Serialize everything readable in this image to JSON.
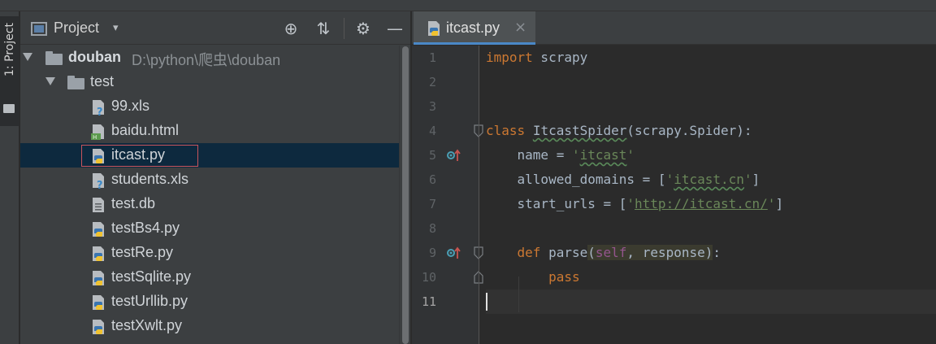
{
  "window": {
    "vertical_tab_label": "1: Project"
  },
  "project_panel": {
    "title": "Project",
    "dropdown_glyph": "▾",
    "header_buttons": [
      {
        "name": "locate-icon",
        "glyph": "⊕"
      },
      {
        "name": "collapse-all-icon",
        "glyph": "⇅"
      },
      {
        "name": "gear-icon",
        "glyph": "⚙"
      },
      {
        "name": "minimize-icon",
        "glyph": "—"
      }
    ],
    "tree": {
      "root": {
        "name": "douban",
        "path": "D:\\python\\爬虫\\douban"
      },
      "folder": {
        "name": "test"
      },
      "files": [
        {
          "name": "99.xls",
          "icon": "unknown-file-icon"
        },
        {
          "name": "baidu.html",
          "icon": "html-file-icon"
        },
        {
          "name": "itcast.py",
          "icon": "python-file-icon",
          "selected": true
        },
        {
          "name": "students.xls",
          "icon": "unknown-file-icon"
        },
        {
          "name": "test.db",
          "icon": "text-file-icon"
        },
        {
          "name": "testBs4.py",
          "icon": "python-file-icon"
        },
        {
          "name": "testRe.py",
          "icon": "python-file-icon"
        },
        {
          "name": "testSqlite.py",
          "icon": "python-file-icon"
        },
        {
          "name": "testUrllib.py",
          "icon": "python-file-icon"
        },
        {
          "name": "testXwlt.py",
          "icon": "python-file-icon"
        }
      ]
    }
  },
  "editor": {
    "tab": {
      "label": "itcast.py",
      "close_glyph": "×"
    },
    "line_numbers": [
      "1",
      "2",
      "3",
      "4",
      "5",
      "6",
      "7",
      "8",
      "9",
      "10",
      "11"
    ],
    "current_line": "11",
    "code": {
      "l1": {
        "kw": "import",
        "rest": " scrapy"
      },
      "l4": {
        "kw": "class",
        "sp": " ",
        "name": "ItcastSpider",
        "rest": "(scrapy.Spider):"
      },
      "l5": {
        "pre": "    name = ",
        "q1": "'",
        "val": "itcast",
        "q2": "'"
      },
      "l6": {
        "pre": "    allowed_domains = [",
        "q1": "'",
        "val": "itcast.cn",
        "q2": "'",
        "post": "]"
      },
      "l7": {
        "pre": "    start_urls = [",
        "q1": "'",
        "val": "http://itcast.cn/",
        "q2": "'",
        "post": "]"
      },
      "l9": {
        "indent": "    ",
        "kw": "def",
        "sp": " ",
        "fname": "parse",
        "open": "(",
        "self": "self",
        "params": ", response",
        "close": ")",
        "colon": ":"
      },
      "l10": {
        "indent": "        ",
        "kw": "pass"
      }
    },
    "colors": {
      "keyword": "#cc7832",
      "string": "#6a8759",
      "self": "#94558d",
      "text": "#a9b7c6",
      "override_marker": "#4a9fb5",
      "up_arrow": "#c75450"
    }
  }
}
